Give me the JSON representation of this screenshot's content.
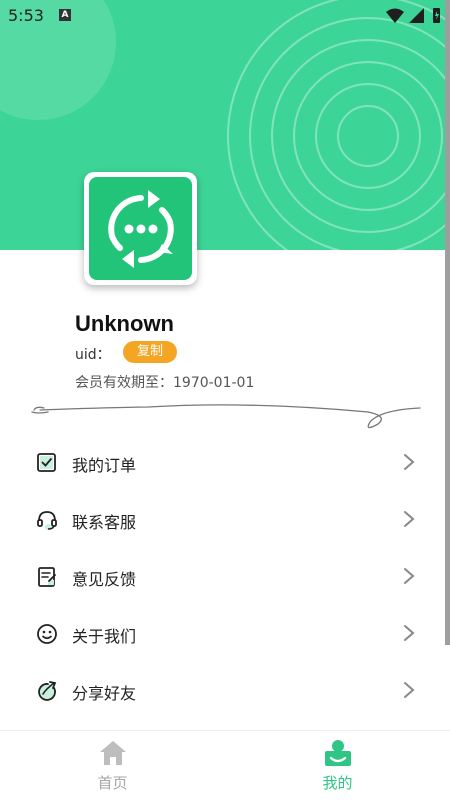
{
  "status_bar": {
    "time": "5:53",
    "notification_badge": "A"
  },
  "profile": {
    "username": "Unknown",
    "uid_label": "uid：",
    "copy_label": "复制",
    "membership_expiry": "会员有效期至：1970-01-01"
  },
  "menu": {
    "items": [
      {
        "label": "我的订单",
        "icon": "order-check-icon"
      },
      {
        "label": "联系客服",
        "icon": "headset-icon"
      },
      {
        "label": "意见反馈",
        "icon": "feedback-note-icon"
      },
      {
        "label": "关于我们",
        "icon": "smiley-icon"
      },
      {
        "label": "分享好友",
        "icon": "share-icon"
      }
    ]
  },
  "bottom_nav": {
    "home_label": "首页",
    "mine_label": "我的",
    "active": "mine"
  },
  "colors": {
    "header": "#3dd597",
    "accent": "#2ec585",
    "copy_button": "#f5a524",
    "logo": "#22c47a"
  }
}
